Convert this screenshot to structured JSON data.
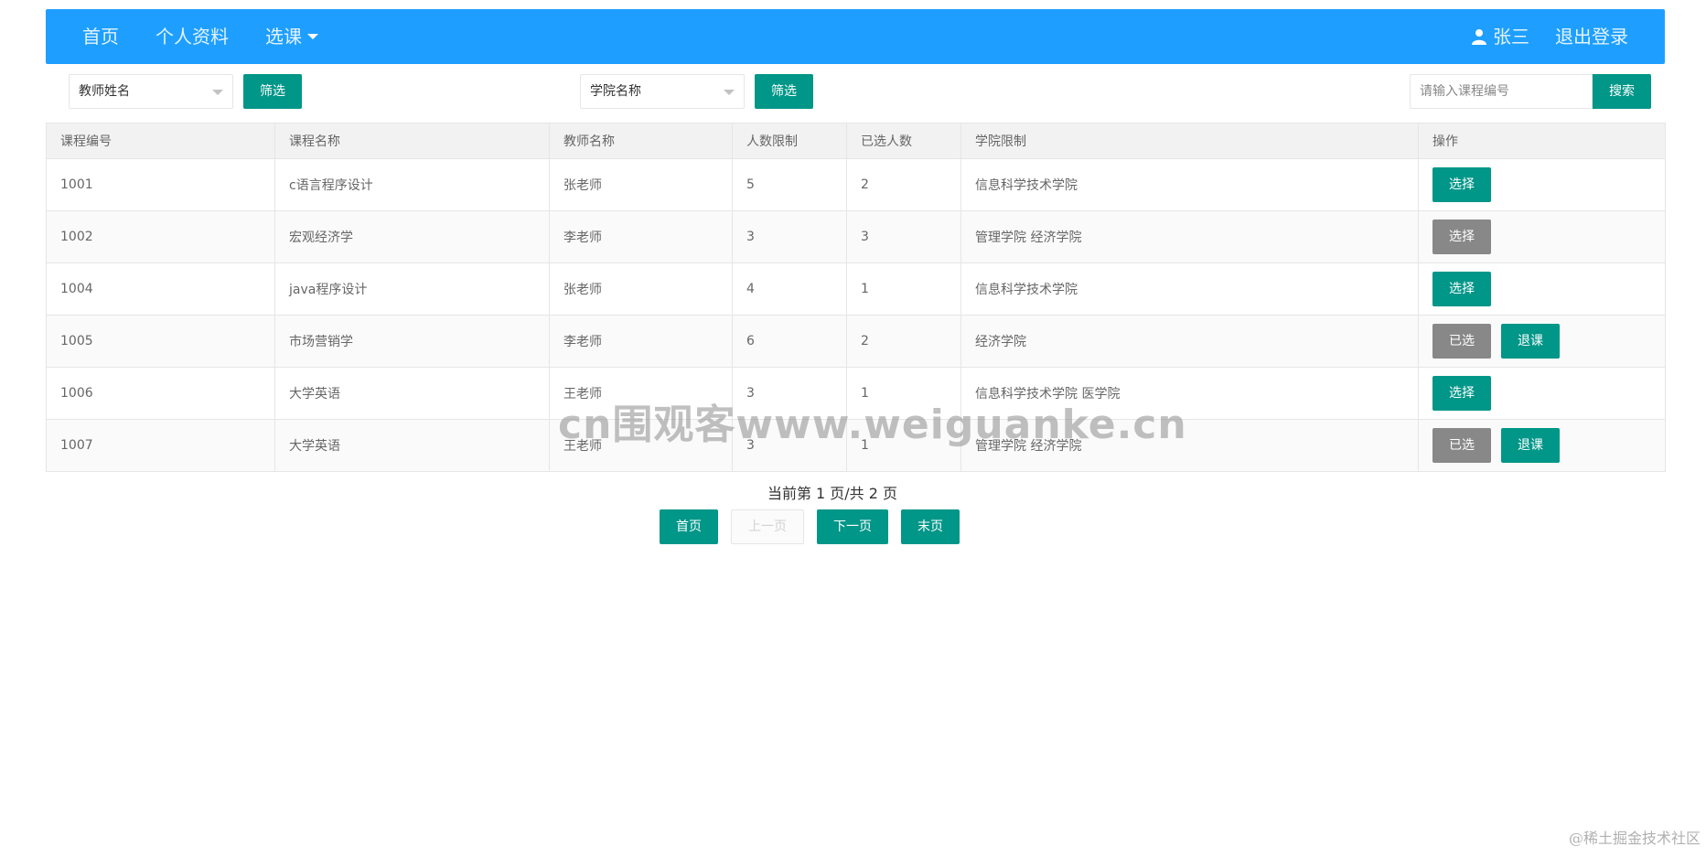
{
  "nav": {
    "home": "首页",
    "profile": "个人资料",
    "select_course": "选课",
    "user_name": "张三",
    "logout": "退出登录"
  },
  "filters": {
    "teacher_select": "教师姓名",
    "teacher_filter_button": "筛选",
    "college_select": "学院名称",
    "college_filter_button": "筛选",
    "search_placeholder": "请输入课程编号",
    "search_button": "搜索"
  },
  "table": {
    "headers": [
      "课程编号",
      "课程名称",
      "教师名称",
      "人数限制",
      "已选人数",
      "学院限制",
      "操作"
    ],
    "rows": [
      {
        "id": "1001",
        "name": "c语言程序设计",
        "teacher": "张老师",
        "limit": "5",
        "selected": "2",
        "college": "信息科学技术学院",
        "primary_action": "选择",
        "primary_state": "available",
        "secondary_action": ""
      },
      {
        "id": "1002",
        "name": "宏观经济学",
        "teacher": "李老师",
        "limit": "3",
        "selected": "3",
        "college": "管理学院  经济学院",
        "primary_action": "选择",
        "primary_state": "full",
        "secondary_action": ""
      },
      {
        "id": "1004",
        "name": "java程序设计",
        "teacher": "张老师",
        "limit": "4",
        "selected": "1",
        "college": "信息科学技术学院",
        "primary_action": "选择",
        "primary_state": "available",
        "secondary_action": ""
      },
      {
        "id": "1005",
        "name": "市场营销学",
        "teacher": "李老师",
        "limit": "6",
        "selected": "2",
        "college": "经济学院",
        "primary_action": "已选",
        "primary_state": "chosen",
        "secondary_action": "退课"
      },
      {
        "id": "1006",
        "name": "大学英语",
        "teacher": "王老师",
        "limit": "3",
        "selected": "1",
        "college": "信息科学技术学院  医学院",
        "primary_action": "选择",
        "primary_state": "available",
        "secondary_action": ""
      },
      {
        "id": "1007",
        "name": "大学英语",
        "teacher": "王老师",
        "limit": "3",
        "selected": "1",
        "college": "管理学院  经济学院",
        "primary_action": "已选",
        "primary_state": "chosen",
        "secondary_action": "退课"
      }
    ]
  },
  "pagination": {
    "info": "当前第 1 页/共 2 页",
    "current_page": 1,
    "total_pages": 2,
    "first": "首页",
    "prev": "上一页",
    "next": "下一页",
    "last": "末页"
  },
  "watermarks": {
    "center": "cn围观客www.weiguanke.cn",
    "corner": "@稀土掘金技术社区"
  },
  "colors": {
    "navbar": "#1e9fff",
    "primary_button": "#009688",
    "gray_button": "#888888",
    "header_row": "#f2f2f2",
    "border": "#e6e6e6"
  },
  "icons": {
    "user": "user-icon",
    "dropdown": "chevron-down-icon"
  }
}
